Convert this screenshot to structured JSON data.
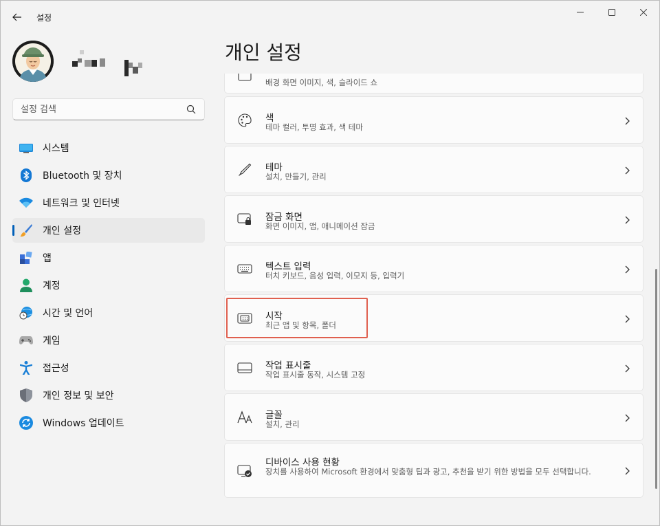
{
  "window": {
    "title": "설정"
  },
  "search": {
    "placeholder": "설정 검색"
  },
  "sidebar": {
    "items": [
      {
        "label": "시스템",
        "icon": "system-icon"
      },
      {
        "label": "Bluetooth 및 장치",
        "icon": "bluetooth-icon"
      },
      {
        "label": "네트워크 및 인터넷",
        "icon": "wifi-icon"
      },
      {
        "label": "개인 설정",
        "icon": "brush-icon",
        "active": true
      },
      {
        "label": "앱",
        "icon": "apps-icon"
      },
      {
        "label": "계정",
        "icon": "account-icon"
      },
      {
        "label": "시간 및 언어",
        "icon": "globe-clock-icon"
      },
      {
        "label": "게임",
        "icon": "gamepad-icon"
      },
      {
        "label": "접근성",
        "icon": "accessibility-icon"
      },
      {
        "label": "개인 정보 및 보안",
        "icon": "shield-icon"
      },
      {
        "label": "Windows 업데이트",
        "icon": "update-icon"
      }
    ]
  },
  "main": {
    "title": "개인 설정",
    "cards": [
      {
        "title": "",
        "desc": "배경 화면 이미지, 색, 슬라이드 쇼",
        "icon": "background-icon"
      },
      {
        "title": "색",
        "desc": "테마 컬러, 투명 효과, 색 테마",
        "icon": "palette-icon"
      },
      {
        "title": "테마",
        "desc": "설치, 만들기, 관리",
        "icon": "pen-icon"
      },
      {
        "title": "잠금 화면",
        "desc": "화면 이미지, 앱, 애니메이션 잠금",
        "icon": "lock-screen-icon"
      },
      {
        "title": "텍스트 입력",
        "desc": "터치 키보드, 음성 입력, 이모지 등, 입력기",
        "icon": "keyboard-icon"
      },
      {
        "title": "시작",
        "desc": "최근 앱 및 항목, 폴더",
        "icon": "start-icon"
      },
      {
        "title": "작업 표시줄",
        "desc": "작업 표시줄 동작, 시스템 고정",
        "icon": "taskbar-icon"
      },
      {
        "title": "글꼴",
        "desc": "설치, 관리",
        "icon": "fonts-icon"
      },
      {
        "title": "디바이스 사용 현황",
        "desc": "장치를 사용하여 Microsoft 환경에서 맞춤형 팁과 광고, 추천을 받기 위한 방법을 모두 선택합니다.",
        "icon": "device-usage-icon"
      }
    ]
  },
  "colors": {
    "accent": "#005fb8",
    "highlight": "#e0604f"
  }
}
